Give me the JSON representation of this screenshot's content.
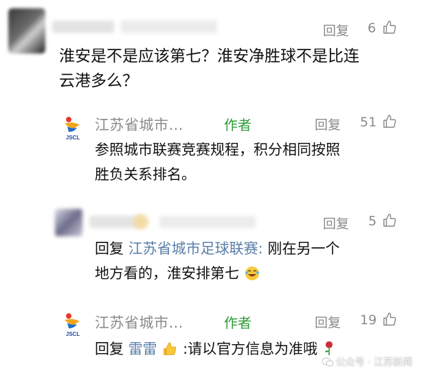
{
  "comments": [
    {
      "reply_label": "回复",
      "likes": "6",
      "text_line1": "淮安是不是应该第七？淮安净胜球不是比连",
      "text_line2": "云港多么？",
      "replies": [
        {
          "author": "江苏省城市…",
          "author_tag": "作者",
          "reply_label": "回复",
          "likes": "51",
          "text_line1": "参照城市联赛竞赛规程，积分相同按照",
          "text_line2": "胜负关系排名。"
        },
        {
          "reply_label": "回复",
          "likes": "5",
          "reply_prefix": "回复",
          "reply_to": "江苏省城市足球联赛:",
          "text_line1_rest": "刚在另一个",
          "text_line2": "地方看的，淮安排第七"
        },
        {
          "author": "江苏省城市…",
          "author_tag": "作者",
          "reply_label": "回复",
          "likes": "19",
          "reply_prefix": "回复",
          "reply_to": "雷雷",
          "text_rest": ":请以官方信息为准哦"
        }
      ]
    }
  ],
  "logo_text": "JSCL",
  "watermark": "公众号 · 江苏新闻",
  "colors": {
    "author_tag": "#2e9c3a",
    "reference_name": "#5b7fa8",
    "meta_gray": "#8a8a8a"
  },
  "icons": [
    "like-icon",
    "laughing-emoji-icon",
    "thumbs-up-emoji-icon",
    "rose-emoji-icon",
    "wechat-icon"
  ]
}
